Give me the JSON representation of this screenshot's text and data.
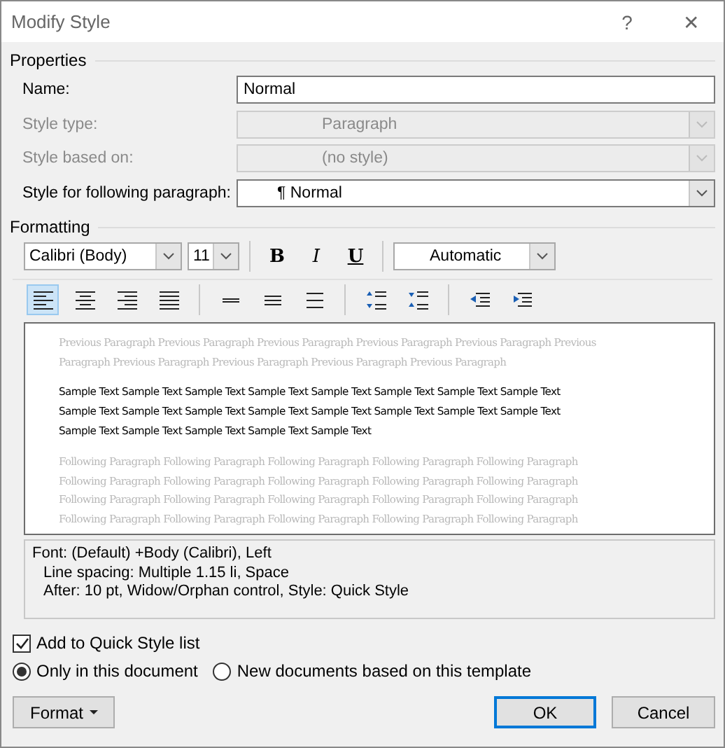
{
  "window": {
    "title": "Modify Style",
    "help": "?",
    "close": "✕"
  },
  "properties": {
    "heading": "Properties",
    "rows": [
      {
        "label": "Name:",
        "value": "Normal",
        "kind": "text",
        "disabled": false
      },
      {
        "label": "Style type:",
        "value": "Paragraph",
        "kind": "select",
        "disabled": true
      },
      {
        "label": "Style based on:",
        "value": "(no style)",
        "kind": "select",
        "disabled": true
      },
      {
        "label": "Style for following paragraph:",
        "value": "Normal",
        "kind": "select",
        "disabled": false,
        "mark": "¶"
      }
    ]
  },
  "formatting": {
    "heading": "Formatting",
    "font": "Calibri (Body)",
    "size": "11",
    "bold": "B",
    "italic": "I",
    "underline": "U",
    "font_color_label": "Automatic",
    "paragraph_buttons": [
      {
        "kind": "align-left",
        "selected": true
      },
      {
        "kind": "align-center",
        "selected": false
      },
      {
        "kind": "align-right",
        "selected": false
      },
      {
        "kind": "justify",
        "selected": false
      },
      {
        "kind": "single",
        "selected": false
      },
      {
        "kind": "one-half",
        "selected": false
      },
      {
        "kind": "double",
        "selected": false
      },
      {
        "kind": "space-more",
        "selected": false
      },
      {
        "kind": "space-less",
        "selected": false
      },
      {
        "kind": "outdent",
        "selected": false
      },
      {
        "kind": "indent",
        "selected": false
      }
    ]
  },
  "preview": {
    "previous": [
      "Previous Paragraph Previous Paragraph Previous Paragraph Previous Paragraph Previous Paragraph Previous",
      "Paragraph Previous Paragraph Previous Paragraph Previous Paragraph Previous Paragraph"
    ],
    "sample": [
      "Sample Text Sample Text Sample Text Sample Text Sample Text Sample Text Sample Text Sample Text",
      "Sample Text Sample Text Sample Text Sample Text Sample Text Sample Text Sample Text Sample Text",
      "Sample Text Sample Text Sample Text Sample Text Sample Text"
    ],
    "following": [
      "Following Paragraph Following Paragraph Following Paragraph Following Paragraph Following Paragraph",
      "Following Paragraph Following Paragraph Following Paragraph Following Paragraph Following Paragraph",
      "Following Paragraph Following Paragraph Following Paragraph Following Paragraph Following Paragraph",
      "Following Paragraph Following Paragraph Following Paragraph Following Paragraph Following Paragraph"
    ]
  },
  "description": [
    "Font: (Default) +Body (Calibri), Left",
    "Line spacing:  Multiple 1.15 li, Space",
    "After:  10 pt, Widow/Orphan control, Style: Quick Style"
  ],
  "add_to_quick_style": {
    "label": "Add to Quick Style list",
    "checked": true
  },
  "scope": [
    {
      "label": "Only in this document",
      "selected": true
    },
    {
      "label": "New documents based on this template",
      "selected": false
    }
  ],
  "buttons": {
    "format": "Format",
    "ok": "OK",
    "cancel": "Cancel"
  }
}
